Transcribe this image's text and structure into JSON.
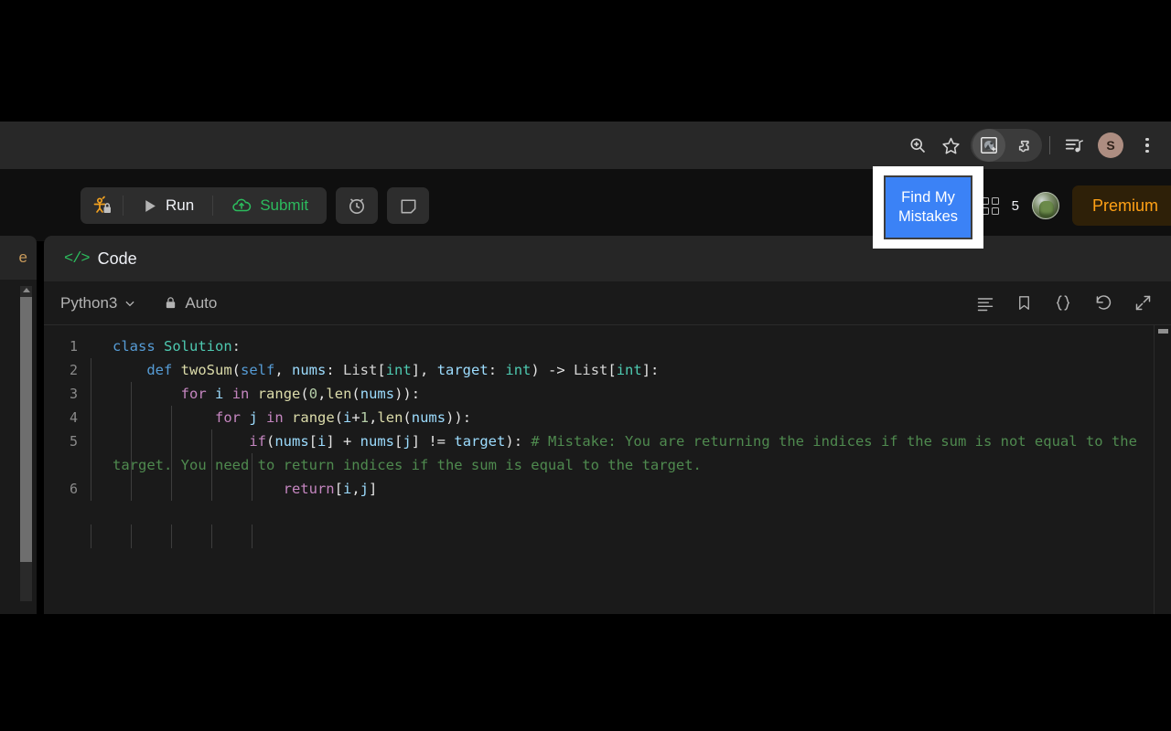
{
  "browser": {
    "icons": [
      {
        "name": "zoom-icon",
        "glyph": "search-plus"
      },
      {
        "name": "bookmark-star-icon",
        "glyph": "star"
      },
      {
        "name": "extension-active-icon",
        "glyph": "puzzle-image"
      },
      {
        "name": "extensions-puzzle-icon",
        "glyph": "puzzle"
      },
      {
        "name": "media-playlist-icon",
        "glyph": "playlist"
      },
      {
        "name": "chrome-menu-icon",
        "glyph": "kebab"
      }
    ],
    "profile_initial": "S"
  },
  "app_nav": {
    "debug_button_label": "",
    "run_label": "Run",
    "submit_label": "Submit",
    "timer_label": "",
    "note_label": "",
    "streak_text": "5",
    "premium_label": "Premium"
  },
  "left_panel": {
    "tab_label": "e"
  },
  "code_panel": {
    "header_title": "Code",
    "header_icon": "</>",
    "language": "Python3",
    "auto_label": "Auto",
    "toolbar_icons": [
      {
        "name": "notes-icon"
      },
      {
        "name": "bookmark-icon"
      },
      {
        "name": "format-braces-icon"
      },
      {
        "name": "reset-undo-icon"
      },
      {
        "name": "expand-fullscreen-icon"
      }
    ]
  },
  "editor": {
    "lines": [
      {
        "number": "1",
        "text": "class Solution:"
      },
      {
        "number": "2",
        "text": "    def twoSum(self, nums: List[int], target: int) -> List[int]:"
      },
      {
        "number": "3",
        "text": "        for i in range(0,len(nums)):"
      },
      {
        "number": "4",
        "text": "            for j in range(i+1,len(nums)):"
      },
      {
        "number": "5",
        "text": "                if(nums[i] + nums[j] != target): # Mistake: You are returning the indices if the sum is not equal to the target. You need to return indices if the sum is equal to the target."
      },
      {
        "number": "6",
        "text": "                    return[i,j]"
      }
    ]
  },
  "overlay": {
    "highlight_button_line1": "Find My",
    "highlight_button_line2": "Mistakes",
    "highlight_color": "#3b82f6"
  }
}
